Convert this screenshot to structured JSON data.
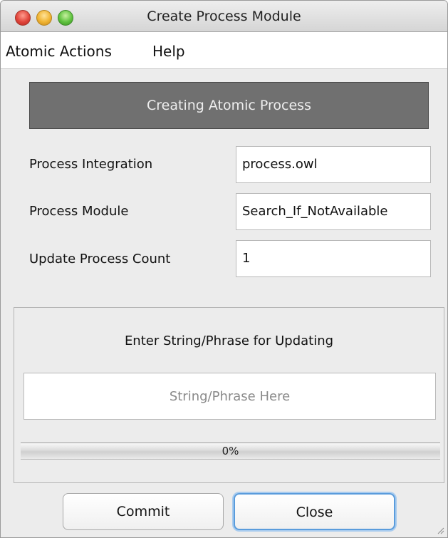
{
  "window": {
    "title": "Create Process Module"
  },
  "menu": {
    "items": [
      "Atomic Actions",
      "Help"
    ]
  },
  "header": {
    "label": "Creating Atomic Process"
  },
  "fields": [
    {
      "label": "Process Integration",
      "value": "process.owl"
    },
    {
      "label": "Process Module",
      "value": "Search_If_NotAvailable"
    },
    {
      "label": "Update Process Count",
      "value": "1"
    }
  ],
  "panel": {
    "title": "Enter String/Phrase for Updating",
    "input_placeholder": "String/Phrase Here",
    "input_value": "",
    "progress_text": "0%",
    "progress_fraction": 0
  },
  "buttons": {
    "commit": "Commit",
    "close": "Close"
  },
  "colors": {
    "header_bg": "#707070",
    "header_text": "#eeeeee",
    "focus_ring": "#5a9cdc",
    "window_bg": "#ececec"
  }
}
